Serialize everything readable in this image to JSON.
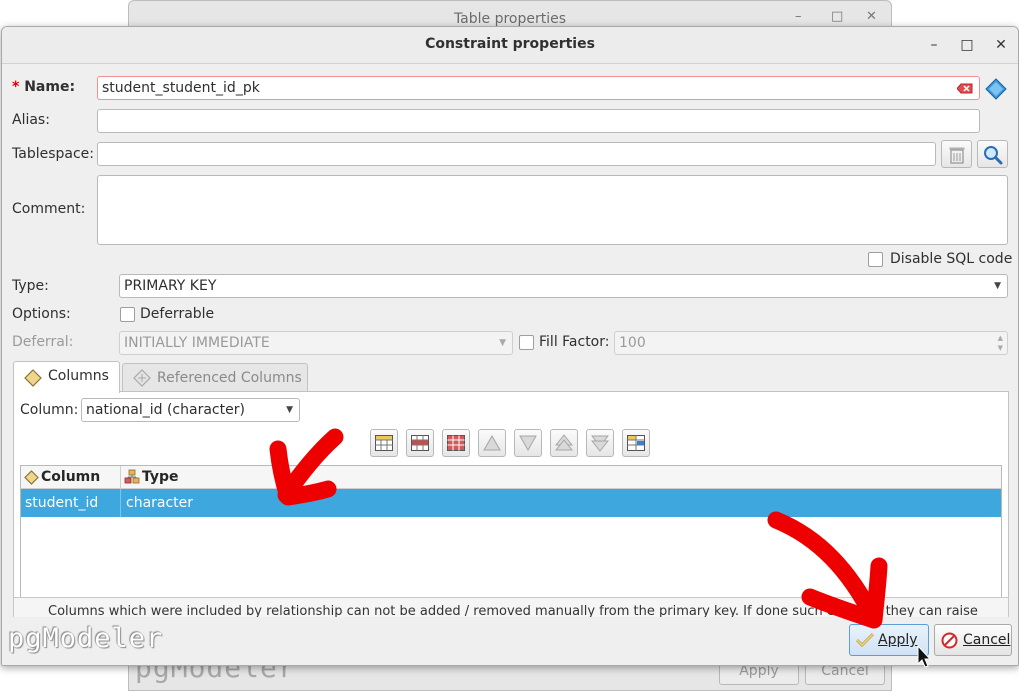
{
  "parent_window": {
    "title": "Table properties",
    "apply_label": "Apply",
    "cancel_label": "Cancel",
    "watermark": "pgModeler"
  },
  "dialog": {
    "title": "Constraint properties",
    "name_label": "Name:",
    "name_value": "student_student_id_pk",
    "alias_label": "Alias:",
    "alias_value": "",
    "tablespace_label": "Tablespace:",
    "tablespace_value": "",
    "comment_label": "Comment:",
    "comment_value": "",
    "disable_sql_label": "Disable SQL code",
    "type_label": "Type:",
    "type_value": "PRIMARY KEY",
    "options_label": "Options:",
    "deferrable_label": "Deferrable",
    "deferral_label": "Deferral:",
    "deferral_value": "INITIALLY IMMEDIATE",
    "fill_factor_label": "Fill Factor:",
    "fill_factor_value": "100",
    "tabs": [
      {
        "label": "Columns",
        "active": true
      },
      {
        "label": "Referenced Columns",
        "active": false
      }
    ],
    "column_label": "Column:",
    "column_value": "national_id (character)",
    "table": {
      "headers": [
        "Column",
        "Type"
      ],
      "rows": [
        {
          "column": "student_id",
          "type": "character",
          "selected": true
        }
      ]
    },
    "info_text": "Columns which were included by relationship can not be added / removed manually from the primary key. If done such changes they can raise",
    "watermark": "pgModeler",
    "apply_label": "Apply",
    "cancel_label": "Cancel"
  },
  "colors": {
    "selection": "#3ea7de",
    "required": "#dd0000",
    "annotation_arrow": "#ee0000"
  }
}
